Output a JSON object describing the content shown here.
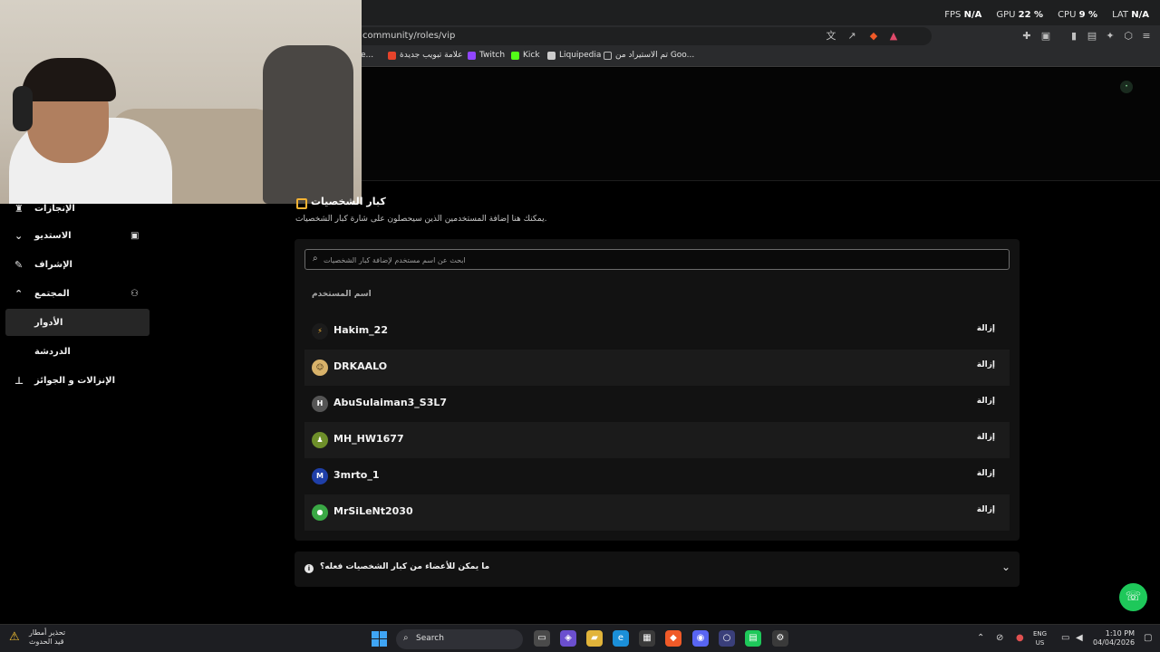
{
  "browser": {
    "url": "community/roles/vip",
    "bookmarks": [
      {
        "label": "e...",
        "color": "#888888"
      },
      {
        "label": "علامة تبويب جديدة",
        "color": "#e5432b"
      },
      {
        "label": "Twitch",
        "color": "#9146ff"
      },
      {
        "label": "Kick",
        "color": "#53fc18"
      },
      {
        "label": "Liquipedia",
        "color": "#cccccc"
      },
      {
        "label": "تم الاستيراد من Goo...",
        "color": "#bbbbbb"
      }
    ]
  },
  "perf": {
    "fps_label": "FPS",
    "fps_value": "N/A",
    "gpu_label": "GPU",
    "gpu_value": "22 %",
    "cpu_label": "CPU",
    "cpu_value": "9 %",
    "lat_label": "LAT",
    "lat_value": "N/A"
  },
  "sidebar": {
    "items": [
      {
        "label": "الإنجازات",
        "icon": "trophy-icon"
      },
      {
        "label": "الاستديو",
        "icon": "chevron-down-icon"
      },
      {
        "label": "الإشراف",
        "icon": "wrench-icon"
      },
      {
        "label": "المجتمع",
        "icon": "chevron-up-icon"
      },
      {
        "label": "الأدوار",
        "icon": ""
      },
      {
        "label": "الدردشة",
        "icon": ""
      },
      {
        "label": "الإنزالات و الجوائز",
        "icon": "drops-icon"
      }
    ]
  },
  "section": {
    "title": "كبار الشخصيات",
    "description": "يمكنك هنا إضافة المستخدمين الذين سيحصلون على شارة كبار الشخصيات."
  },
  "search": {
    "placeholder": "ابحث عن اسم مستخدم لإضافة كبار الشخصيات"
  },
  "table": {
    "column_header": "اسم المستخدم",
    "remove_label": "إزالة",
    "rows": [
      {
        "username": "Hakim_22",
        "avatar_color": "#1b1b1b",
        "avatar_text": "⚡"
      },
      {
        "username": "DRKAALO",
        "avatar_color": "#d8b26a",
        "avatar_text": "☺"
      },
      {
        "username": "AbuSulaiman3_S3L7",
        "avatar_color": "#555555",
        "avatar_text": "H"
      },
      {
        "username": "MH_HW1677",
        "avatar_color": "#6e8f2a",
        "avatar_text": "♟"
      },
      {
        "username": "3mrto_1",
        "avatar_color": "#1f3fa8",
        "avatar_text": "M"
      },
      {
        "username": "MrSiLeNt2030",
        "avatar_color": "#3aa845",
        "avatar_text": "●"
      }
    ]
  },
  "faq": {
    "question": "ما يمكن للأعضاء من كبار الشخصيات فعله؟"
  },
  "taskbar": {
    "weather_line1": "تحذير أمطار",
    "weather_line2": "قيد الحدوث",
    "search_label": "Search",
    "lang_line1": "ENG",
    "lang_line2": "US",
    "time": "1:10 PM",
    "date": "04/04/2026"
  }
}
